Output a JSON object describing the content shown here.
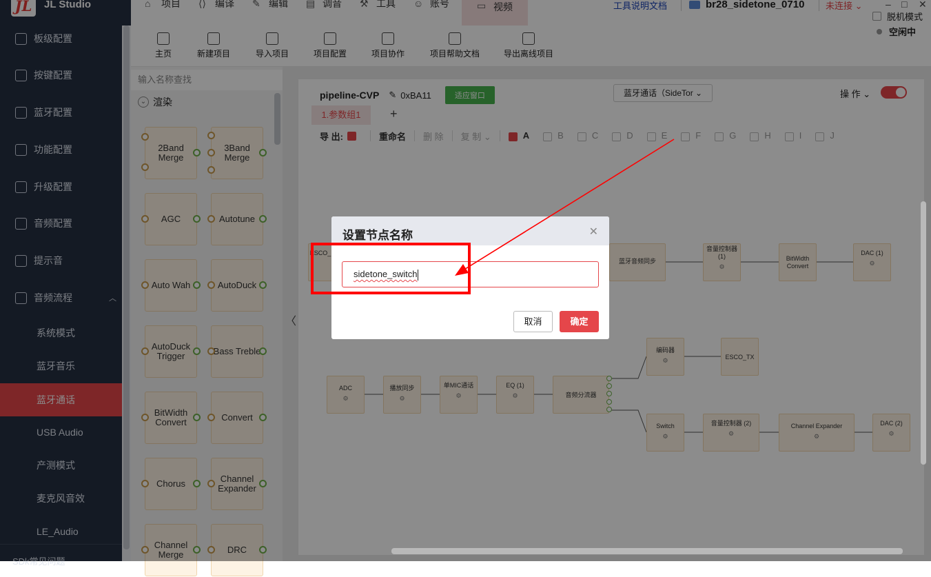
{
  "app": {
    "logo_mark": "JL",
    "title": "JL Studio"
  },
  "topnav": [
    {
      "label": "项目",
      "icon": "home-icon"
    },
    {
      "label": "编译",
      "icon": "code-icon"
    },
    {
      "label": "编辑",
      "icon": "edit-icon"
    },
    {
      "label": "调音",
      "icon": "monitor-icon"
    },
    {
      "label": "工具",
      "icon": "tools-icon"
    },
    {
      "label": "账号",
      "icon": "user-icon"
    },
    {
      "label": "视频",
      "icon": "video-icon"
    }
  ],
  "topright": {
    "doc_link": "工具说明文档",
    "project_name": "br28_sidetone_0710",
    "connection": "未连接"
  },
  "window_controls": {
    "minimize": "–",
    "maximize": "□",
    "close": "✕"
  },
  "sidebar": {
    "items": [
      {
        "label": "板级配置"
      },
      {
        "label": "按键配置"
      },
      {
        "label": "蓝牙配置"
      },
      {
        "label": "功能配置"
      },
      {
        "label": "升级配置"
      },
      {
        "label": "音频配置"
      },
      {
        "label": "提示音"
      },
      {
        "label": "音频流程"
      }
    ],
    "sub_items": [
      {
        "label": "系统模式"
      },
      {
        "label": "蓝牙音乐"
      },
      {
        "label": "蓝牙通话"
      },
      {
        "label": "USB Audio"
      },
      {
        "label": "产测模式"
      },
      {
        "label": "麦克风音效"
      },
      {
        "label": "LE_Audio"
      }
    ],
    "footer": "SDk常见问题"
  },
  "toolbar": {
    "buttons": [
      {
        "label": "主页"
      },
      {
        "label": "新建项目"
      },
      {
        "label": "导入项目"
      },
      {
        "label": "项目配置"
      },
      {
        "label": "项目协作"
      },
      {
        "label": "项目帮助文档"
      },
      {
        "label": "导出离线项目"
      }
    ],
    "offline_mode": "脱机模式",
    "status": "空闲中"
  },
  "library": {
    "search_placeholder": "输入名称查找",
    "group": "渲染",
    "nodes": [
      "2Band Merge",
      "3Band Merge",
      "AGC",
      "Autotune",
      "Auto Wah",
      "AutoDuck",
      "AutoDuck Trigger",
      "Bass Treble",
      "BitWidth Convert",
      "Convert",
      "Chorus",
      "Channel Expander",
      "Channel Merge",
      "DRC"
    ]
  },
  "pipeline": {
    "name": "pipeline-CVP",
    "address": "0xBA11",
    "fit_button": "适应窗口",
    "mode_select": "蓝牙通话（SideTor",
    "operation": "操 作",
    "tab": "1.参数组1",
    "tab_add": "+",
    "export_label": "导 出:",
    "rename": "重命名",
    "delete": "删 除",
    "copy": "复 制",
    "groups": [
      "A",
      "B",
      "C",
      "D",
      "E",
      "F",
      "G",
      "H",
      "I",
      "J"
    ],
    "graph_nodes": {
      "esco": "ESCO_",
      "sync": "蓝牙音频同步",
      "vol1": "音量控制器(1)",
      "bitwidth": "BitWidth Convert",
      "dac1": "DAC (1)",
      "encoder": "编码器",
      "esco_tx": "ESCO_TX",
      "adc": "ADC",
      "play_sync": "播放同步",
      "mic": "单MIC通话",
      "eq": "EQ (1)",
      "splitter": "音频分流器",
      "switch": "Switch",
      "vol2": "音量控制器 (2)",
      "expander": "Channel Expander",
      "dac2": "DAC (2)"
    }
  },
  "dialog": {
    "title": "设置节点名称",
    "input_value": "sidetone_switch",
    "cancel": "取消",
    "ok": "确定"
  },
  "colors": {
    "accent": "#e5464a",
    "sidebar_bg": "#263042",
    "annotation": "#ff0000"
  }
}
